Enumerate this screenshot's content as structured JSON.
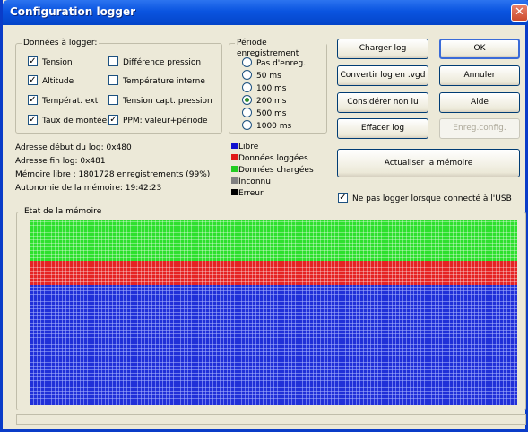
{
  "window": {
    "title": "Configuration logger",
    "close_glyph": "✕"
  },
  "data_group": {
    "legend": "Données à logger:",
    "items": [
      {
        "label": "Tension",
        "checked": true
      },
      {
        "label": "Différence pression",
        "checked": false
      },
      {
        "label": "Altitude",
        "checked": true
      },
      {
        "label": "Température interne",
        "checked": false
      },
      {
        "label": "Températ. ext",
        "checked": true
      },
      {
        "label": "Tension capt. pression",
        "checked": false
      },
      {
        "label": "Taux de montée",
        "checked": true
      },
      {
        "label": "PPM: valeur+période",
        "checked": true
      }
    ]
  },
  "period_group": {
    "legend": "Période enregistrement",
    "options": [
      "Pas d'enreg.",
      "50 ms",
      "100 ms",
      "200 ms",
      "500 ms",
      "1000 ms"
    ],
    "selected": "200 ms"
  },
  "buttons": {
    "charger_log": "Charger log",
    "ok": "OK",
    "convertir_log": "Convertir log en .vgd",
    "annuler": "Annuler",
    "considerer_non_lu": "Considérer non lu",
    "aide": "Aide",
    "effacer_log": "Effacer log",
    "enreg_config": "Enreg.config.",
    "actualiser_memoire": "Actualiser la mémoire"
  },
  "info": {
    "adresse_debut": "Adresse début du log: 0x480",
    "adresse_fin": "Adresse fin log: 0x481",
    "memoire_libre": "Mémoire libre : 1801728 enregistrements (99%)",
    "autonomie": "Autonomie de la mémoire: 19:42:23"
  },
  "legend": [
    {
      "label": "Libre",
      "color": "#1010d0"
    },
    {
      "label": "Données loggées",
      "color": "#e01818"
    },
    {
      "label": "Données chargées",
      "color": "#22cc22"
    },
    {
      "label": "Inconnu",
      "color": "#808080"
    },
    {
      "label": "Erreur",
      "color": "#000000"
    }
  ],
  "usb_checkbox": {
    "label": "Ne pas logger lorsque connecté à l'USB",
    "checked": true
  },
  "memory_state": {
    "legend": "Etat de la mémoire",
    "segments": [
      {
        "state": "Données chargées",
        "fraction": 0.22
      },
      {
        "state": "Données loggées",
        "fraction": 0.13
      },
      {
        "state": "Libre",
        "fraction": 0.65
      }
    ]
  }
}
